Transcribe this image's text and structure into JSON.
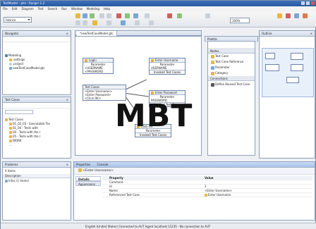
{
  "window": {
    "title": "TestMaster - plm - Ranger 1.2"
  },
  "menu": [
    "File",
    "Edit",
    "Diagram",
    "Test",
    "Search",
    "Run",
    "Window",
    "Modeling",
    "Help"
  ],
  "toolbar": {
    "perspective": "Fabrice",
    "zoom": "100%"
  },
  "navigator": {
    "title": "Navigator",
    "items": [
      "Modeling",
      ".settings",
      ".project",
      "newTestCaseModel.gtc"
    ]
  },
  "testcases": {
    "title": "Test Cases",
    "items": [
      "Test Cases",
      "01_02_03 - Executable Tes",
      "01_04 - Tests with",
      "04 - Tests with the l",
      "05 - Tests with the l",
      "WORK",
      "..."
    ]
  },
  "problems": {
    "title": "Problems",
    "summary": "0 items",
    "column": "Description",
    "item": "Infos (1 items)"
  },
  "editor": {
    "tab": "*newTestCaseModel.gtc",
    "nodes": [
      {
        "title": "Login",
        "rows": [
          "Parameter",
          "<USERNAME",
          "<PASSWORD"
        ],
        "footer": ""
      },
      {
        "title": "Enter Username",
        "rows": [
          "Parameter",
          "USERNAME"
        ],
        "footer": "Invoked Test Cases"
      },
      {
        "title": "Test Cases",
        "rows": [
          "<Enter Username>",
          "<Enter Password>",
          "<Click OK>"
        ],
        "footer": ""
      },
      {
        "title": "Enter Password",
        "rows": [
          "Parameter",
          "PASSWORD"
        ],
        "footer": "Invoked Test Cases"
      },
      {
        "title": "Click OK",
        "rows": [
          "Parameter"
        ],
        "footer": "Invoked Test Cases"
      }
    ]
  },
  "watermark": "MBT",
  "palette": {
    "title": "Palette",
    "groups": [
      {
        "label": "Nodes",
        "items": [
          "Test Case",
          "Test Case Reference",
          "Parameter",
          "Category"
        ]
      },
      {
        "label": "Connections",
        "items": [
          "Define Reused Test Case"
        ]
      }
    ]
  },
  "outline": {
    "title": "Outline"
  },
  "properties": {
    "tabs": [
      "Properties",
      "Console"
    ],
    "selection": "<Enter Username>",
    "sections": [
      "Details",
      "Appearance"
    ],
    "headers": [
      "Property",
      "Value"
    ],
    "rows": [
      {
        "k": "Comment",
        "v": ""
      },
      {
        "k": "Id",
        "v": "3"
      },
      {
        "k": "Name",
        "v": "<Enter Username>"
      },
      {
        "k": "Referenced Test Case",
        "v": "Enter Username"
      }
    ]
  },
  "statusbar": {
    "text": "English (United States)  Connected to AUT Agent localhost:11235 - No connection to AUT"
  },
  "colors": {
    "accent": "#245aa3",
    "nodeIcon": "#e0b23c"
  }
}
